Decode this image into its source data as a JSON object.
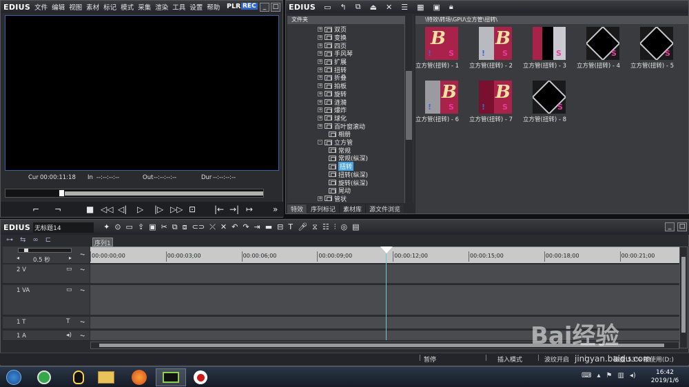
{
  "colors": {
    "accent": "#4aa3e8",
    "rec": "#2f66c7",
    "playhead": "#6cc8d0",
    "taskbar": "#1c2430"
  },
  "player": {
    "logo": "EDIUS",
    "menu": [
      "文件",
      "编辑",
      "视图",
      "素材",
      "标记",
      "模式",
      "采集",
      "渲染",
      "工具",
      "设置",
      "帮助"
    ],
    "plr": "PLR",
    "rec": "REC",
    "cur_label": "Cur",
    "cur_value": "00:00:11:18",
    "in_label": "In",
    "in_value": "--:--:--:--",
    "out_label": "Out",
    "out_value": "--:--:--:--",
    "dur_label": "Dur",
    "dur_value": "--:--:--:--"
  },
  "library": {
    "logo": "EDIUS",
    "folder_header": "文件夹",
    "path": "\\特效\\转场\\GPU\\立方管\\扭转\\",
    "tree": [
      {
        "label": "双页",
        "expander": "+"
      },
      {
        "label": "变换",
        "expander": "+"
      },
      {
        "label": "四页",
        "expander": "+"
      },
      {
        "label": "手风琴",
        "expander": "+"
      },
      {
        "label": "扩展",
        "expander": "+"
      },
      {
        "label": "扭转",
        "expander": "+"
      },
      {
        "label": "折叠",
        "expander": "+"
      },
      {
        "label": "拍板",
        "expander": "+"
      },
      {
        "label": "旋转",
        "expander": "+"
      },
      {
        "label": "涟漪",
        "expander": "+"
      },
      {
        "label": "爆炸",
        "expander": "+"
      },
      {
        "label": "球化",
        "expander": "+"
      },
      {
        "label": "百叶窗滚动",
        "expander": "+"
      },
      {
        "label": "相册",
        "expander": ""
      },
      {
        "label": "立方管",
        "expander": "-"
      },
      {
        "label": "常规",
        "expander": ""
      },
      {
        "label": "常规(纵深)",
        "expander": ""
      },
      {
        "label": "扭转",
        "expander": "",
        "selected": true
      },
      {
        "label": "扭转(纵深)",
        "expander": ""
      },
      {
        "label": "旋转(纵深)",
        "expander": ""
      },
      {
        "label": "晃动",
        "expander": ""
      },
      {
        "label": "管状",
        "expander": "+"
      }
    ],
    "tabs": [
      "特效",
      "序列标记",
      "素材库",
      "源文件浏览"
    ],
    "thumbnails": [
      {
        "label": "立方管(扭转) - 1",
        "style": "B-red"
      },
      {
        "label": "立方管(扭转) - 2",
        "style": "B-white"
      },
      {
        "label": "立方管(扭转) - 3",
        "style": "dark-cube"
      },
      {
        "label": "立方管(扭转) - 4",
        "style": "diamond"
      },
      {
        "label": "立方管(扭转) - 5",
        "style": "diamond"
      },
      {
        "label": "立方管(扭转) - 6",
        "style": "B-grey"
      },
      {
        "label": "立方管(扭转) - 7",
        "style": "B-red2"
      },
      {
        "label": "立方管(扭转) - 8",
        "style": "diamond2"
      }
    ]
  },
  "timeline": {
    "logo": "EDIUS",
    "project": "无标题14",
    "sequence_tab": "序列1",
    "zoom": "0.5 秒",
    "ruler": [
      "00:00:00;00",
      "00:00:03;00",
      "00:00:06;00",
      "00:00:09;00",
      "00:00:12;00",
      "00:00:15;00",
      "00:00:18;00",
      "00:00:21;00"
    ],
    "tracks": [
      {
        "label": "2 V",
        "icon": "monitor-icon"
      },
      {
        "label": "1 VA",
        "icon": "monitor-icon"
      },
      {
        "label": "1 T",
        "icon": "T"
      },
      {
        "label": "1 A",
        "icon": "speaker-icon"
      }
    ],
    "status": {
      "pause": "暂停",
      "insert_mode": "插入模式",
      "ripple": "波纹开启",
      "disk": "磁盘:53% 被使用(D:)"
    }
  },
  "taskbar": {
    "time": "16:42",
    "date": "2019/1/6"
  },
  "watermark": {
    "brand": "Bai经验",
    "url": "jingyan.baidu.com"
  }
}
